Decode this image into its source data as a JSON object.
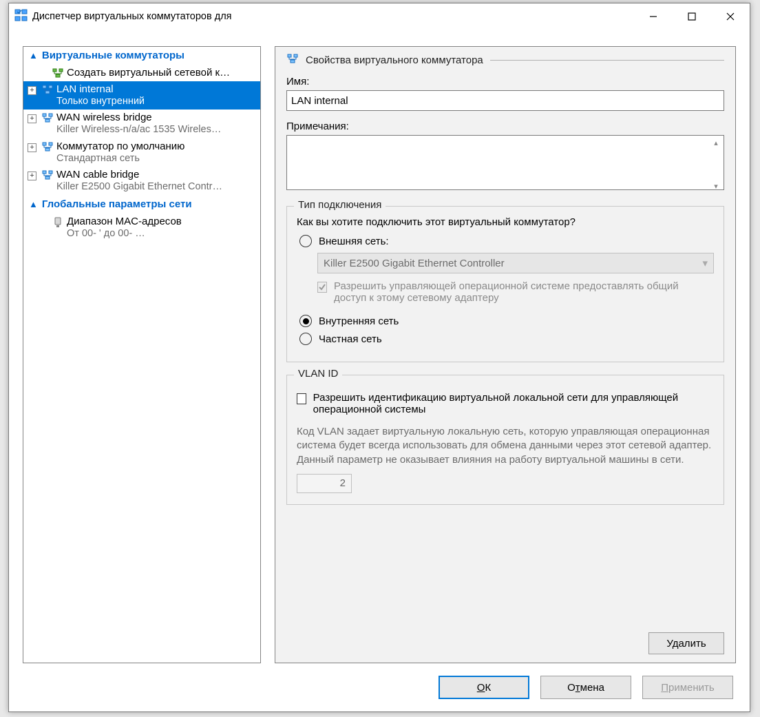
{
  "window": {
    "title": "Диспетчер виртуальных коммутаторов для"
  },
  "tree": {
    "groups": {
      "switches_header": "Виртуальные коммутаторы",
      "global_header": "Глобальные параметры сети"
    },
    "create_item": "Создать виртуальный сетевой к…",
    "items": [
      {
        "name": "LAN internal",
        "sub": "Только внутренний",
        "selected": true
      },
      {
        "name": "WAN wireless bridge",
        "sub": "Killer Wireless-n/a/ac 1535 Wireles…",
        "selected": false
      },
      {
        "name": "Коммутатор по умолчанию",
        "sub": "Стандартная сеть",
        "selected": false
      },
      {
        "name": "WAN cable bridge",
        "sub": "Killer E2500 Gigabit Ethernet Contr…",
        "selected": false
      }
    ],
    "mac_item": {
      "name": "Диапазон MAC-адресов",
      "sub": "От 00-                    ' до 00-        …"
    }
  },
  "props": {
    "section_title": "Свойства виртуального коммутатора",
    "name_label": "Имя:",
    "name_value": "LAN internal",
    "notes_label": "Примечания:",
    "notes_value": "",
    "conn_group": "Тип подключения",
    "conn_question": "Как вы хотите подключить этот виртуальный коммутатор?",
    "radio_external": "Внешняя сеть:",
    "external_adapter": "Killer E2500 Gigabit Ethernet Controller",
    "allow_mgmt_os": "Разрешить управляющей операционной системе предоставлять общий доступ к этому сетевому адаптеру",
    "radio_internal": "Внутренняя сеть",
    "radio_private": "Частная сеть",
    "vlan_group": "VLAN ID",
    "vlan_enable": "Разрешить идентификацию виртуальной локальной сети для управляющей операционной системы",
    "vlan_desc": "Код VLAN задает виртуальную локальную сеть, которую управляющая операционная система будет всегда использовать для обмена данными через этот сетевой адаптер. Данный параметр не оказывает влияния на работу виртуальной машины в сети.",
    "vlan_value": "2",
    "delete_btn": "Удалить"
  },
  "footer": {
    "ok": "ОК",
    "cancel": "Отмена",
    "apply": "Применить"
  }
}
